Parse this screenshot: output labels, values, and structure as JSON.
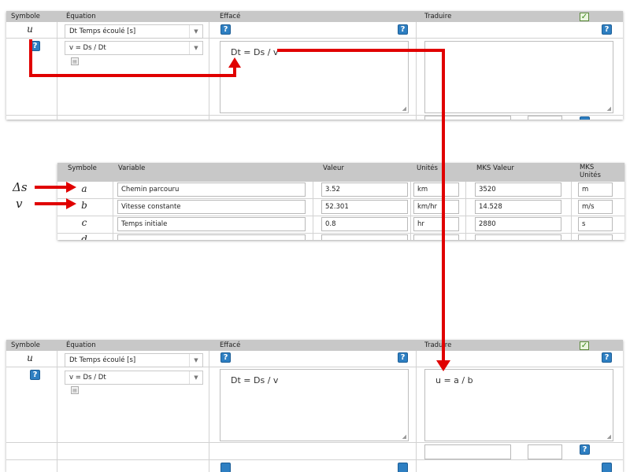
{
  "eq_panel_top": {
    "headers": {
      "symbol": "Symbole",
      "equation": "Équation",
      "effect": "Effacé",
      "translate": "Traduire"
    },
    "symbol": "u",
    "help_glyph": "?",
    "select_variable": "Dt Temps écoulé [s]",
    "select_equation": "v = Ds / Dt",
    "effect_text": "Dt = Ds / v",
    "translate_text": "",
    "checkbox_checked": true
  },
  "var_table": {
    "headers": {
      "symbol": "Symbole",
      "variable": "Variable",
      "value": "Valeur",
      "units": "Unités",
      "mks_value": "MKS Valeur",
      "mks_units_line1": "MKS",
      "mks_units_line2": "Unités"
    },
    "rows": [
      {
        "symbol": "a",
        "variable": "Chemin parcouru",
        "value": "3.52",
        "units": "km",
        "mks_value": "3520",
        "mks_units": "m"
      },
      {
        "symbol": "b",
        "variable": "Vitesse constante",
        "value": "52.301",
        "units": "km/hr",
        "mks_value": "14.528",
        "mks_units": "m/s"
      },
      {
        "symbol": "c",
        "variable": "Temps initiale",
        "value": "0.8",
        "units": "hr",
        "mks_value": "2880",
        "mks_units": "s"
      },
      {
        "symbol": "d",
        "variable": "",
        "value": "",
        "units": "",
        "mks_value": "",
        "mks_units": ""
      }
    ]
  },
  "eq_panel_bottom": {
    "headers": {
      "symbol": "Symbole",
      "equation": "Équation",
      "effect": "Effacé",
      "translate": "Traduire"
    },
    "symbol": "u",
    "help_glyph": "?",
    "select_variable": "Dt Temps écoulé [s]",
    "select_equation": "v = Ds / Dt",
    "effect_text": "Dt = Ds / v",
    "translate_text": "u = a / b",
    "checkbox_checked": true
  },
  "annotations": {
    "delta_s": "Δs",
    "v": "v"
  },
  "colors": {
    "arrow": "#e00000",
    "header_bg": "#c8c8c8",
    "help_blue": "#2e7fc2"
  }
}
